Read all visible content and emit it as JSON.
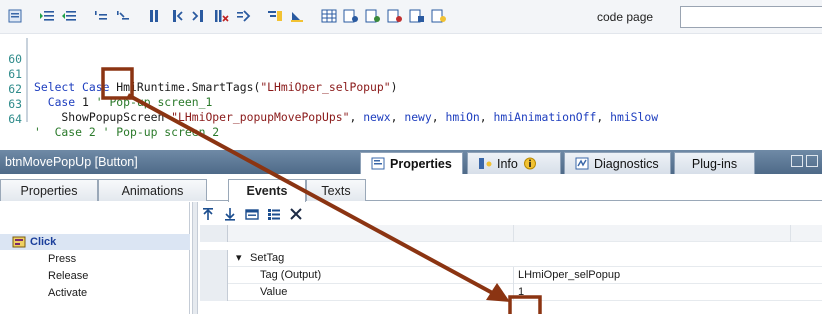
{
  "editor": {
    "toolbar": {
      "icons": [
        "script-icon",
        "indent-increase-icon",
        "indent-decrease-icon",
        "comment-icon",
        "uncomment-icon",
        "bookmark-icon",
        "bookmark-prev-icon",
        "bookmark-next-icon",
        "bookmark-clear-icon",
        "go-to-icon",
        "syntax-icon",
        "sync-icon",
        "table-icon",
        "list-icon",
        "list-add-icon",
        "list-remove-icon",
        "list-edit-icon",
        "list-run-icon"
      ],
      "code_page_label": "code page",
      "code_page_value": ""
    },
    "lines": [
      {
        "num": "60",
        "text": ""
      },
      {
        "num": "61",
        "text": "Select Case HmiRuntime.SmartTags(\"LHmiOper_selPopup\")"
      },
      {
        "num": "62",
        "text": "  Case 1 ' Pop-up screen_1"
      },
      {
        "num": "63",
        "text": "    ShowPopupScreen \"LHmiOper_popupMovePopUps\", newx, newy, hmiOn, hmiAnimationOff, hmiSlow"
      },
      {
        "num": "64",
        "text": "'  Case 2 ' Pop-up screen_2"
      }
    ]
  },
  "panel": {
    "title": "btnMovePopUp [Button]",
    "header_tabs": [
      {
        "label": "Properties",
        "icon": "properties-icon"
      },
      {
        "label": "Info",
        "icon": "info-icon"
      },
      {
        "label": "Diagnostics",
        "icon": "diagnostics-icon"
      },
      {
        "label": "Plug-ins",
        "icon": ""
      }
    ],
    "sub_tabs": [
      "Properties",
      "Animations",
      "Events",
      "Texts"
    ],
    "events": {
      "group": "Click",
      "items": [
        "Press",
        "Release",
        "Activate"
      ]
    },
    "grid": {
      "function": "SetTag",
      "rows": [
        {
          "name": "Tag (Output)",
          "value": "LHmiOper_selPopup"
        },
        {
          "name": "Value",
          "value": "1"
        }
      ]
    }
  },
  "annotation": {
    "color": "#8b3412"
  }
}
